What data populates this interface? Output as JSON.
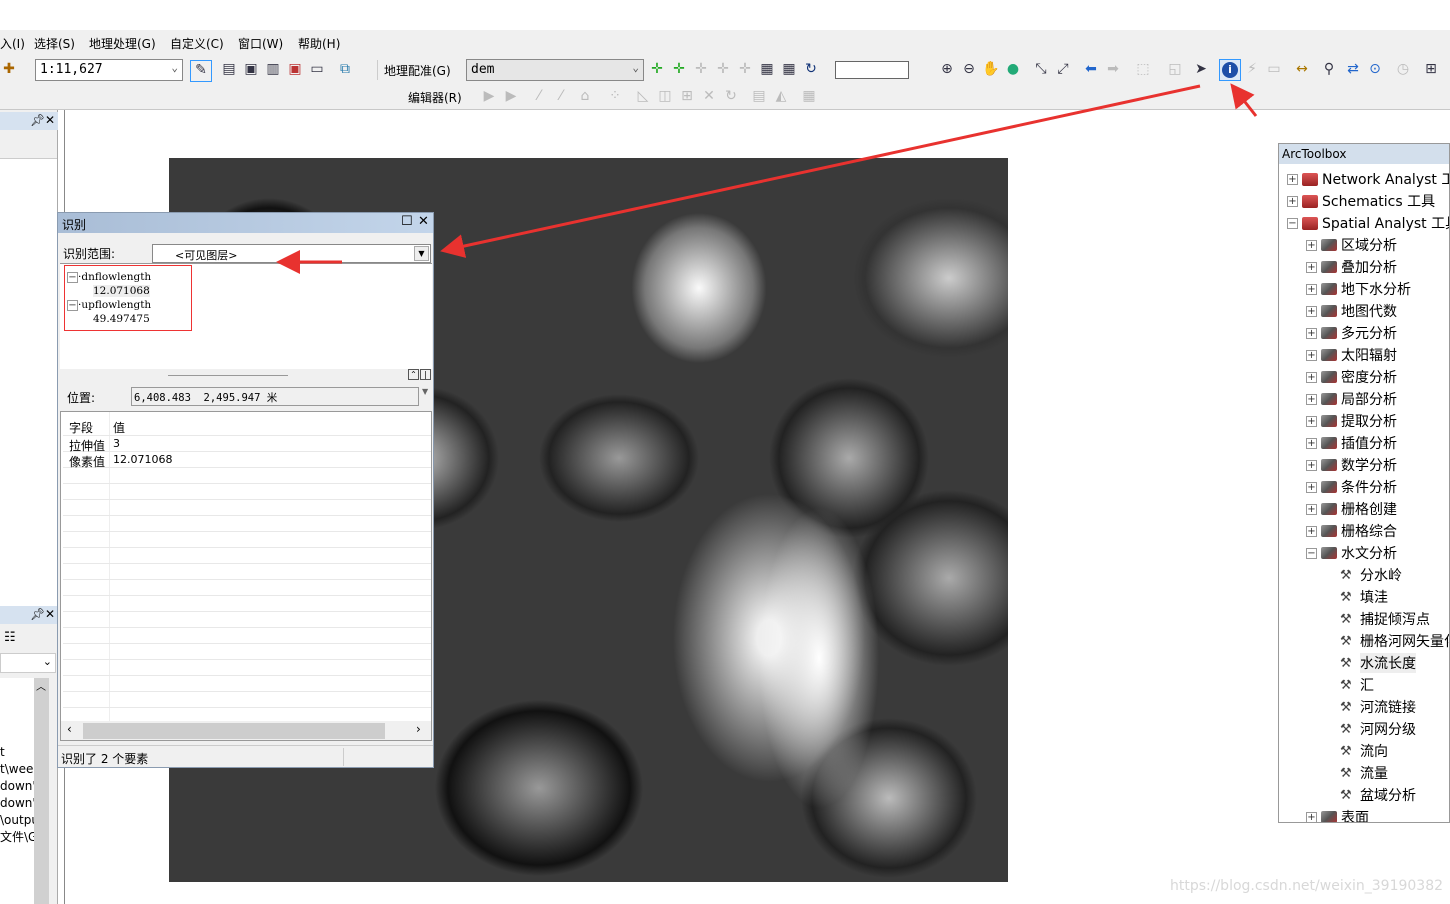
{
  "menubar": {
    "items": [
      "入(I)",
      "选择(S)",
      "地理处理(G)",
      "自定义(C)",
      "窗口(W)",
      "帮助(H)"
    ]
  },
  "toolbar": {
    "scale": "1:11,627",
    "georef_label": "地理配准(G)",
    "layer_select": "dem",
    "editor_label": "编辑器(R)",
    "coord_input": ""
  },
  "left_panel": {
    "partial_lines": [
      "t",
      "t\\wee",
      "down'",
      "down'",
      "\\outpu",
      "文件\\GI"
    ]
  },
  "identify": {
    "title": "识别",
    "scope_label": "识别范围:",
    "scope_value": "<可见图层>",
    "tree": [
      {
        "layer": "dnflowlength",
        "value": "12.071068"
      },
      {
        "layer": "upflowlength",
        "value": "49.497475"
      }
    ],
    "location_label": "位置:",
    "location_value": "6,408.483  2,495.947 米",
    "columns": [
      "字段",
      "值"
    ],
    "rows": [
      {
        "field": "拉伸值",
        "value": "3"
      },
      {
        "field": "像素值",
        "value": "12.071068"
      }
    ],
    "status": "识别了 2 个要素"
  },
  "toolbox": {
    "title": "ArcToolbox",
    "top": [
      "Network Analyst 工具",
      "Schematics 工具",
      "Spatial Analyst 工具"
    ],
    "sets": [
      "区域分析",
      "叠加分析",
      "地下水分析",
      "地图代数",
      "多元分析",
      "太阳辐射",
      "密度分析",
      "局部分析",
      "提取分析",
      "插值分析",
      "数学分析",
      "条件分析",
      "栅格创建",
      "栅格综合",
      "水文分析"
    ],
    "hydro_tools": [
      "分水岭",
      "填洼",
      "捕捉倾泻点",
      "栅格河网矢量化",
      "水流长度",
      "汇",
      "河流链接",
      "河网分级",
      "流向",
      "流量",
      "盆域分析"
    ],
    "last": "表面",
    "selected_tool": "水流长度"
  },
  "watermark": "https://blog.csdn.net/weixin_39190382",
  "colors": {
    "annotation": "#e8322f",
    "title_bar": "#b4c8e0"
  }
}
